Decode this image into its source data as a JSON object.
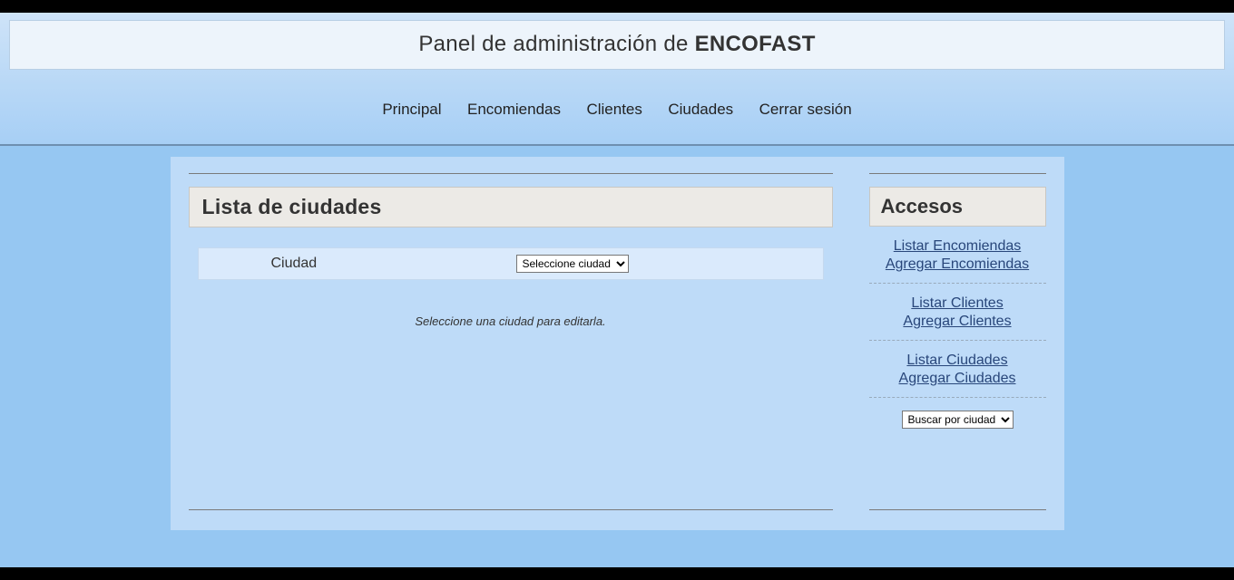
{
  "header": {
    "title_prefix": "Panel de administración de ",
    "title_brand": "ENCOFAST"
  },
  "nav": {
    "principal": "Principal",
    "encomiendas": "Encomiendas",
    "clientes": "Clientes",
    "ciudades": "Ciudades",
    "cerrar": "Cerrar sesión"
  },
  "main": {
    "title": "Lista de ciudades",
    "field_label": "Ciudad",
    "select_option": "Seleccione ciudad",
    "helper": "Seleccione una ciudad para editarla."
  },
  "side": {
    "title": "Accesos",
    "group1": {
      "a": "Listar Encomiendas",
      "b": "Agregar Encomiendas"
    },
    "group2": {
      "a": "Listar Clientes",
      "b": "Agregar Clientes"
    },
    "group3": {
      "a": "Listar Ciudades",
      "b": "Agregar Ciudades"
    },
    "search_option": "Buscar por ciudad"
  }
}
